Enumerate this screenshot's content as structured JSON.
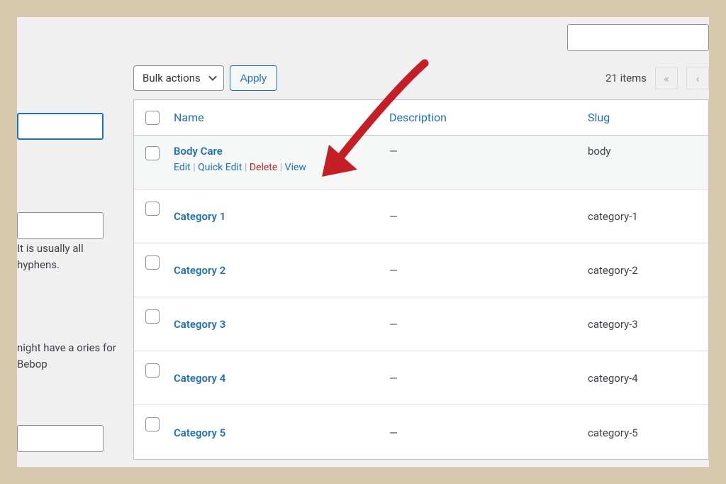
{
  "toolbar": {
    "bulk_label": "Bulk actions",
    "apply_label": "Apply",
    "items_count": "21 items",
    "pag_first": "«",
    "pag_prev": "‹"
  },
  "sidebar": {
    "text1": "It is usually all hyphens.",
    "text2": "night have a ories for Bebop"
  },
  "columns": {
    "name": "Name",
    "description": "Description",
    "slug": "Slug"
  },
  "rows": [
    {
      "name": "Body Care",
      "description": "—",
      "slug": "body",
      "hover": true,
      "actions": {
        "edit": "Edit",
        "quick_edit": "Quick Edit",
        "delete": "Delete",
        "view": "View"
      }
    },
    {
      "name": "Category 1",
      "description": "—",
      "slug": "category-1",
      "hover": false
    },
    {
      "name": "Category 2",
      "description": "—",
      "slug": "category-2",
      "hover": false
    },
    {
      "name": "Category 3",
      "description": "—",
      "slug": "category-3",
      "hover": false
    },
    {
      "name": "Category 4",
      "description": "—",
      "slug": "category-4",
      "hover": false
    },
    {
      "name": "Category 5",
      "description": "—",
      "slug": "category-5",
      "hover": false
    }
  ]
}
